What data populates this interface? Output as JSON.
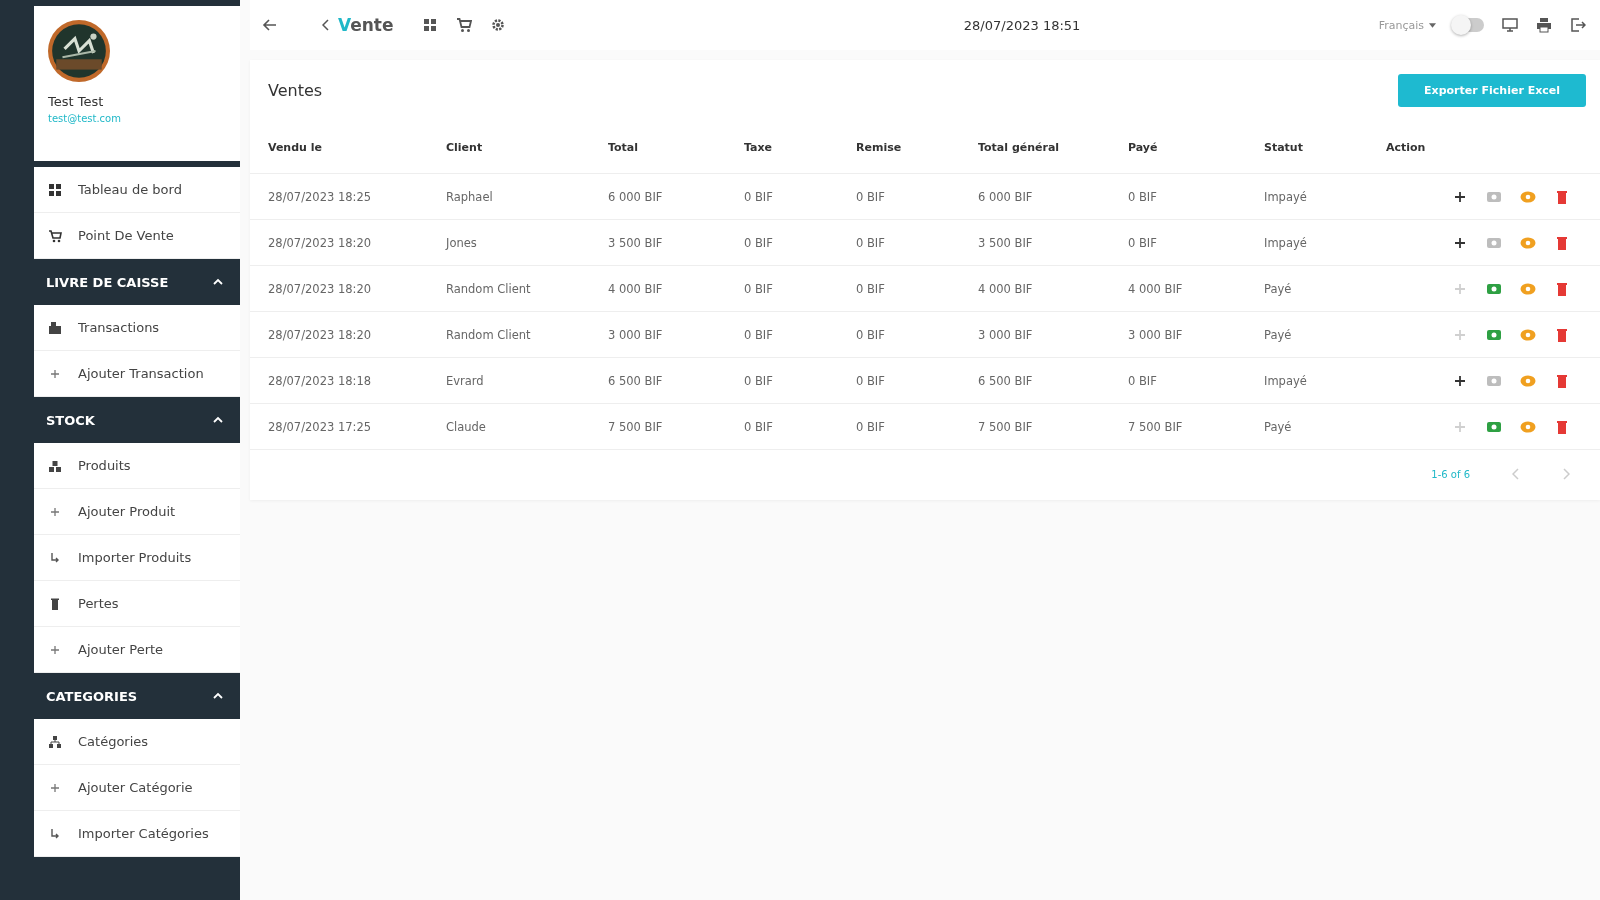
{
  "profile": {
    "name": "Test Test",
    "email": "test@test.com"
  },
  "nav": [
    {
      "label": "Tableau de bord",
      "kind": "grid"
    },
    {
      "label": "Point De Vente",
      "kind": "cart"
    }
  ],
  "sections": [
    {
      "title": "LIVRE DE CAISSE",
      "expanded": true,
      "items": [
        {
          "label": "Transactions",
          "kind": "cash"
        },
        {
          "label": "Ajouter Transaction",
          "kind": "plus"
        }
      ]
    },
    {
      "title": "STOCK",
      "expanded": true,
      "items": [
        {
          "label": "Produits",
          "kind": "boxes"
        },
        {
          "label": "Ajouter Produit",
          "kind": "plus"
        },
        {
          "label": "Importer Produits",
          "kind": "import"
        },
        {
          "label": "Pertes",
          "kind": "trash"
        },
        {
          "label": "Ajouter Perte",
          "kind": "plus"
        }
      ]
    },
    {
      "title": "CATEGORIES",
      "expanded": true,
      "items": [
        {
          "label": "Catégories",
          "kind": "tree"
        },
        {
          "label": "Ajouter Catégorie",
          "kind": "plus"
        },
        {
          "label": "Importer Catégories",
          "kind": "import"
        }
      ]
    }
  ],
  "topbar": {
    "brand_initial": "V",
    "brand_rest": "ente",
    "datetime": "28/07/2023 18:51",
    "language": "Français",
    "dark_mode": false
  },
  "page_title": "Ventes",
  "export_button": "Exporter Fichier Excel",
  "table": {
    "columns": [
      "Vendu le",
      "Client",
      "Total",
      "Taxe",
      "Remise",
      "Total général",
      "Payé",
      "Statut",
      "Action"
    ],
    "rows": [
      {
        "cells": [
          "28/07/2023 18:25",
          "Raphael",
          "6 000 BIF",
          "0 BIF",
          "0 BIF",
          "6 000 BIF",
          "0 BIF",
          "Impayé"
        ],
        "paid": false
      },
      {
        "cells": [
          "28/07/2023 18:20",
          "Jones",
          "3 500 BIF",
          "0 BIF",
          "0 BIF",
          "3 500 BIF",
          "0 BIF",
          "Impayé"
        ],
        "paid": false
      },
      {
        "cells": [
          "28/07/2023 18:20",
          "Random Client",
          "4 000 BIF",
          "0 BIF",
          "0 BIF",
          "4 000 BIF",
          "4 000 BIF",
          "Payé"
        ],
        "paid": true
      },
      {
        "cells": [
          "28/07/2023 18:20",
          "Random Client",
          "3 000 BIF",
          "0 BIF",
          "0 BIF",
          "3 000 BIF",
          "3 000 BIF",
          "Payé"
        ],
        "paid": true
      },
      {
        "cells": [
          "28/07/2023 18:18",
          "Evrard",
          "6 500 BIF",
          "0 BIF",
          "0 BIF",
          "6 500 BIF",
          "0 BIF",
          "Impayé"
        ],
        "paid": false
      },
      {
        "cells": [
          "28/07/2023 17:25",
          "Claude",
          "7 500 BIF",
          "0 BIF",
          "0 BIF",
          "7 500 BIF",
          "7 500 BIF",
          "Payé"
        ],
        "paid": true
      }
    ]
  },
  "pagination": {
    "range": "1-6 of 6",
    "prev_disabled": true,
    "next_disabled": true
  }
}
